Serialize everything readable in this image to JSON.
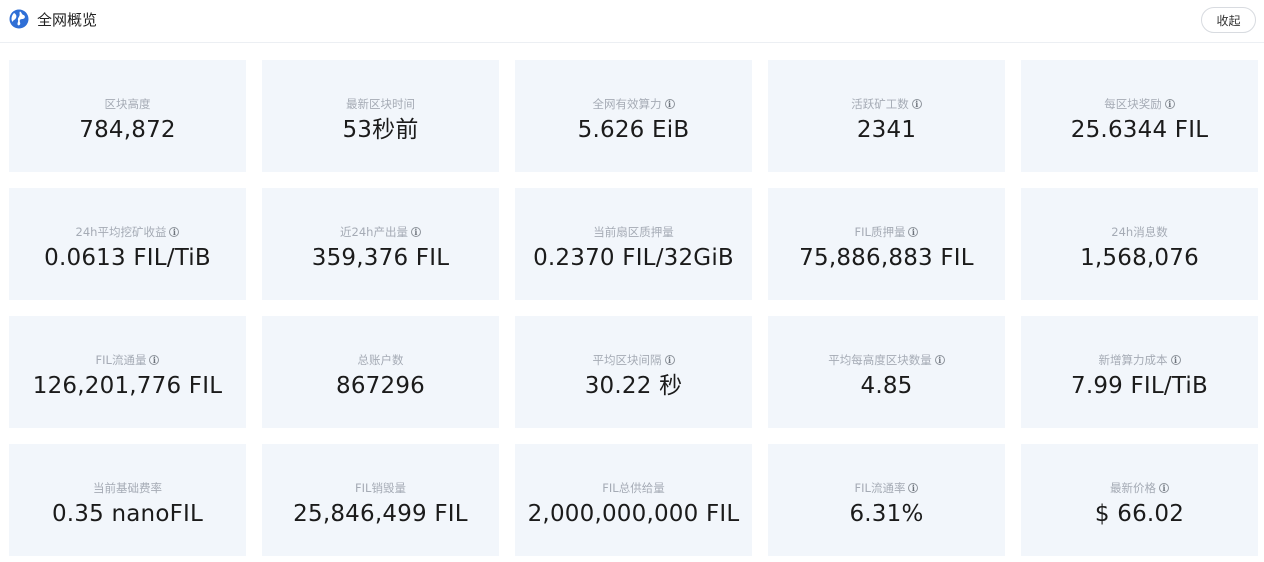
{
  "header": {
    "title": "全网概览",
    "collapse_label": "收起"
  },
  "cards": [
    {
      "label": "区块高度",
      "value": "784,872",
      "info": false
    },
    {
      "label": "最新区块时间",
      "value": "53秒前",
      "info": false
    },
    {
      "label": "全网有效算力",
      "value": "5.626 EiB",
      "info": true
    },
    {
      "label": "活跃矿工数",
      "value": "2341",
      "info": true
    },
    {
      "label": "每区块奖励",
      "value": "25.6344 FIL",
      "info": true
    },
    {
      "label": "24h平均挖矿收益",
      "value": "0.0613 FIL/TiB",
      "info": true
    },
    {
      "label": "近24h产出量",
      "value": "359,376 FIL",
      "info": true
    },
    {
      "label": "当前扇区质押量",
      "value": "0.2370 FIL/32GiB",
      "info": false
    },
    {
      "label": "FIL质押量",
      "value": "75,886,883 FIL",
      "info": true
    },
    {
      "label": "24h消息数",
      "value": "1,568,076",
      "info": false
    },
    {
      "label": "FIL流通量",
      "value": "126,201,776 FIL",
      "info": true
    },
    {
      "label": "总账户数",
      "value": "867296",
      "info": false
    },
    {
      "label": "平均区块间隔",
      "value": "30.22 秒",
      "info": true
    },
    {
      "label": "平均每高度区块数量",
      "value": "4.85",
      "info": true
    },
    {
      "label": "新增算力成本",
      "value": "7.99 FIL/TiB",
      "info": true
    },
    {
      "label": "当前基础费率",
      "value": "0.35 nanoFIL",
      "info": false
    },
    {
      "label": "FIL销毁量",
      "value": "25,846,499 FIL",
      "info": false
    },
    {
      "label": "FIL总供给量",
      "value": "2,000,000,000 FIL",
      "info": false
    },
    {
      "label": "FIL流通率",
      "value": "6.31%",
      "info": true
    },
    {
      "label": "最新价格",
      "value": "$ 66.02",
      "info": true
    }
  ],
  "icons": {
    "globe": "globe-icon",
    "info": "info-icon"
  },
  "colors": {
    "card_bg": "#f2f6fb",
    "globe": "#2f6fd6"
  }
}
